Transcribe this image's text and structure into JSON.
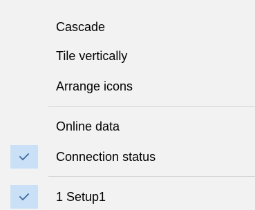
{
  "menu": {
    "items": [
      {
        "label": "Cascade",
        "checked": false
      },
      {
        "label": "Tile vertically",
        "checked": false
      },
      {
        "label": "Arrange icons",
        "checked": false
      },
      {
        "label": "Online data",
        "checked": false
      },
      {
        "label": "Connection status",
        "checked": true
      },
      {
        "label": "1 Setup1",
        "checked": true
      }
    ],
    "check_icon": "checkmark-icon",
    "colors": {
      "background": "#f2f2f2",
      "check_highlight": "#c9e0f7",
      "checkmark": "#3a6a9e",
      "separator": "#d7d7d7",
      "text": "#000000"
    }
  }
}
